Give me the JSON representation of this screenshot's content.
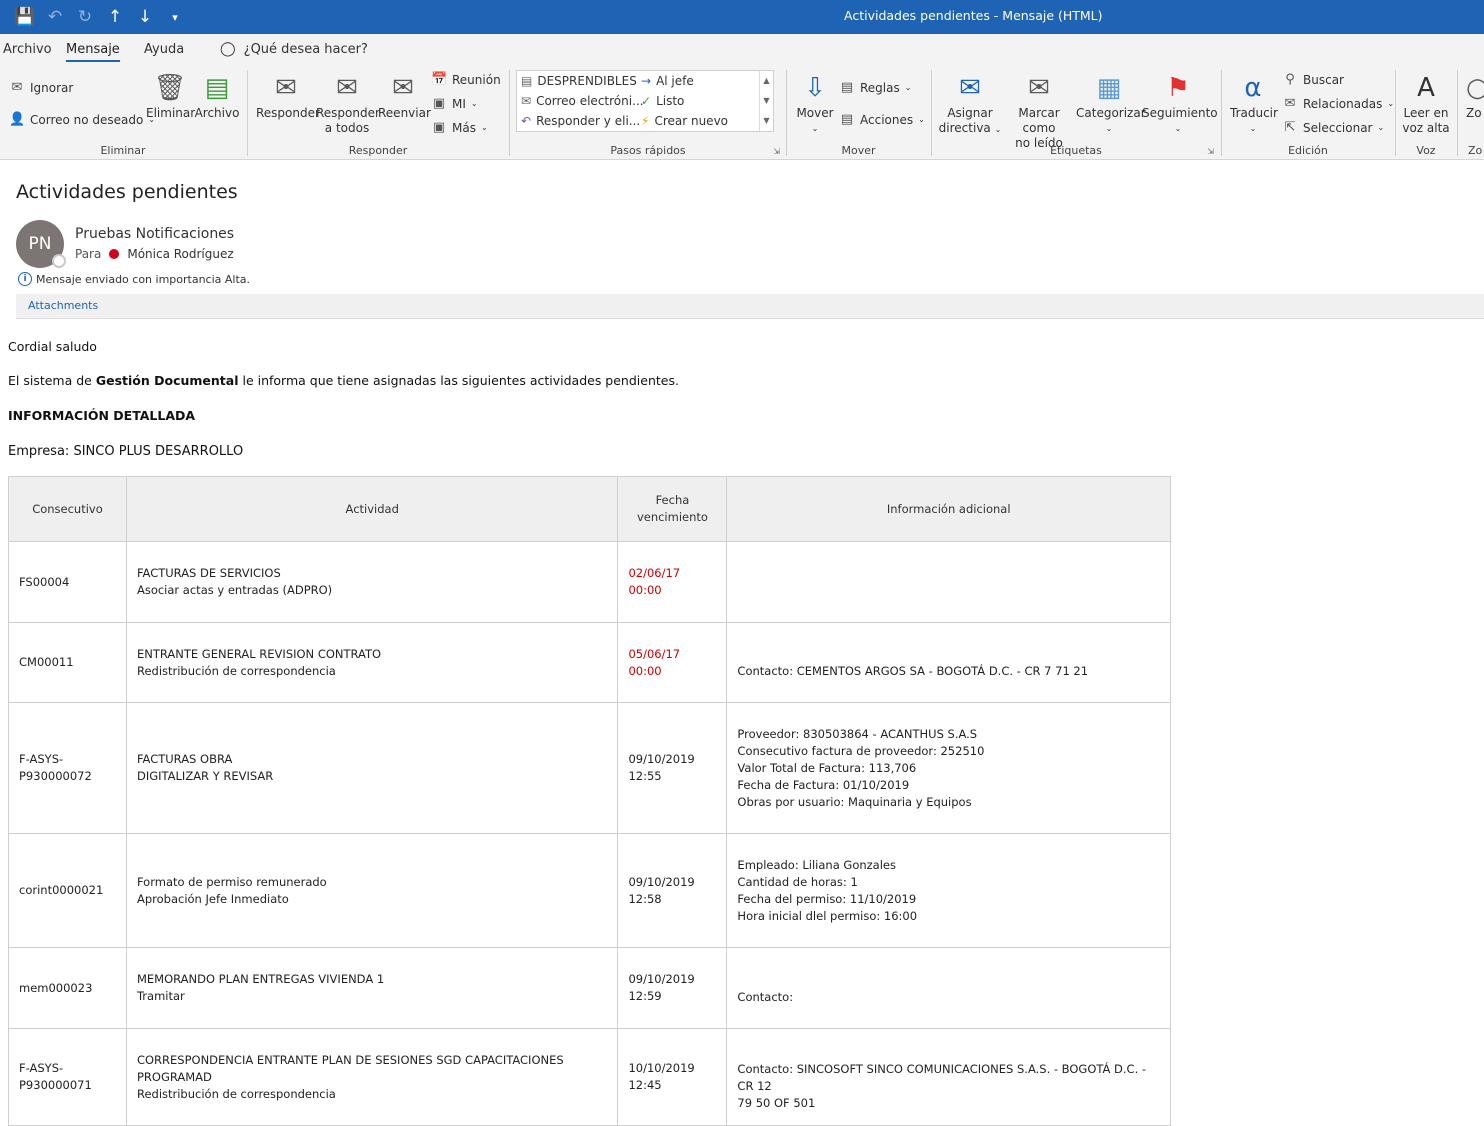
{
  "window": {
    "title": "Actividades pendientes  -  Mensaje (HTML)"
  },
  "menu": {
    "tabs": [
      "Archivo",
      "Mensaje",
      "Ayuda"
    ],
    "search_text": "¿Qué desea hacer?"
  },
  "ribbon": {
    "eliminar": {
      "label": "Eliminar",
      "ignorar": "Ignorar",
      "correo_no_deseado": "Correo no deseado",
      "eliminar_btn": "Eliminar",
      "archivo_btn": "Archivo"
    },
    "responder": {
      "label": "Responder",
      "responder": "Responder",
      "responder_todos_1": "Responder",
      "responder_todos_2": "a todos",
      "reenviar": "Reenviar",
      "reunion": "Reunión",
      "mi": "MI",
      "mas": "Más"
    },
    "pasos": {
      "label": "Pasos rápidos",
      "items": [
        "DESPRENDIBLES",
        "Correo electróni...",
        "Responder y eli...",
        "Al jefe",
        "Listo",
        "Crear nuevo"
      ]
    },
    "mover": {
      "label": "Mover",
      "mover": "Mover",
      "reglas": "Reglas",
      "acciones": "Acciones"
    },
    "etiquetas": {
      "label": "Etiquetas",
      "asignar_1": "Asignar",
      "asignar_2": "directiva",
      "marcar_1": "Marcar como",
      "marcar_2": "no leído",
      "categorizar": "Categorizar",
      "seguimiento": "Seguimiento"
    },
    "edicion": {
      "label": "Edición",
      "traducir": "Traducir",
      "buscar": "Buscar",
      "relacionadas": "Relacionadas",
      "seleccionar": "Seleccionar"
    },
    "voz": {
      "label": "Voz",
      "leer_1": "Leer en",
      "leer_2": "voz alta"
    },
    "zoom": {
      "label": "Zo",
      "btn": "Zo"
    }
  },
  "message": {
    "subject": "Actividades pendientes",
    "avatar_initials": "PN",
    "sender": "Pruebas Notificaciones",
    "to_label": "Para",
    "recipient": "Mónica Rodríguez",
    "importance": "Mensaje enviado con importancia Alta.",
    "attachments": "Attachments"
  },
  "body": {
    "greeting": "Cordial saludo",
    "intro_pre": "El sistema de ",
    "intro_bold": "Gestión Documental",
    "intro_post": " le informa que tiene asignadas las siguientes actividades pendientes.",
    "section_title": "INFORMACIÓN DETALLADA",
    "empresa": "Empresa: SINCO PLUS DESARROLLO"
  },
  "table": {
    "headers": {
      "consecutivo": "Consecutivo",
      "actividad": "Actividad",
      "fecha_1": "Fecha",
      "fecha_2": "vencimiento",
      "info": "Información adicional"
    },
    "rows": [
      {
        "consecutivo": [
          "FS00004"
        ],
        "actividad": [
          "FACTURAS DE SERVICIOS",
          "Asociar actas y entradas (ADPRO)"
        ],
        "fecha": [
          "02/06/17 00:00"
        ],
        "overdue": true,
        "info": []
      },
      {
        "consecutivo": [
          "CM00011"
        ],
        "actividad": [
          "ENTRANTE GENERAL REVISION CONTRATO",
          "Redistribución de correspondencia"
        ],
        "fecha": [
          "05/06/17 00:00"
        ],
        "overdue": true,
        "info": [
          "Contacto: CEMENTOS ARGOS SA - BOGOTÁ D.C. - CR 7 71 21"
        ]
      },
      {
        "consecutivo": [
          "F-ASYS-",
          "P930000072"
        ],
        "actividad": [
          "FACTURAS OBRA",
          "DIGITALIZAR Y REVISAR"
        ],
        "fecha": [
          "09/10/2019",
          "12:55"
        ],
        "overdue": false,
        "info": [
          "Proveedor: 830503864 - ACANTHUS S.A.S",
          "Consecutivo factura de proveedor: 252510",
          "Valor Total de Factura: 113,706",
          "Fecha de Factura: 01/10/2019",
          "Obras por usuario: Maquinaria y Equipos"
        ]
      },
      {
        "consecutivo": [
          "corint0000021"
        ],
        "actividad": [
          "Formato de permiso remunerado",
          "Aprobación Jefe Inmediato"
        ],
        "fecha": [
          "09/10/2019",
          "12:58"
        ],
        "overdue": false,
        "info": [
          "Empleado: Liliana Gonzales",
          "Cantidad de horas: 1",
          "Fecha del permiso: 11/10/2019",
          "Hora inicial dlel permiso: 16:00"
        ]
      },
      {
        "consecutivo": [
          "mem000023"
        ],
        "actividad": [
          "MEMORANDO PLAN ENTREGAS VIVIENDA 1",
          "Tramitar"
        ],
        "fecha": [
          "09/10/2019",
          "12:59"
        ],
        "overdue": false,
        "info": [
          "Contacto:"
        ]
      },
      {
        "consecutivo": [
          "F-ASYS-",
          "P930000071"
        ],
        "actividad": [
          "CORRESPONDENCIA ENTRANTE PLAN DE SESIONES SGD CAPACITACIONES PROGRAMAD",
          "Redistribución de correspondencia"
        ],
        "fecha": [
          "10/10/2019",
          "12:45"
        ],
        "overdue": false,
        "info": [
          "Contacto: SINCOSOFT SINCO COMUNICACIONES S.A.S. - BOGOTÁ D.C. - CR 12",
          "79 50 OF 501"
        ]
      }
    ]
  },
  "colors": {
    "titlebar": "#1f64b4",
    "ribbon_bg": "#f3f3f3",
    "overdue": "#cc0000",
    "avatar": "#7d7573"
  }
}
